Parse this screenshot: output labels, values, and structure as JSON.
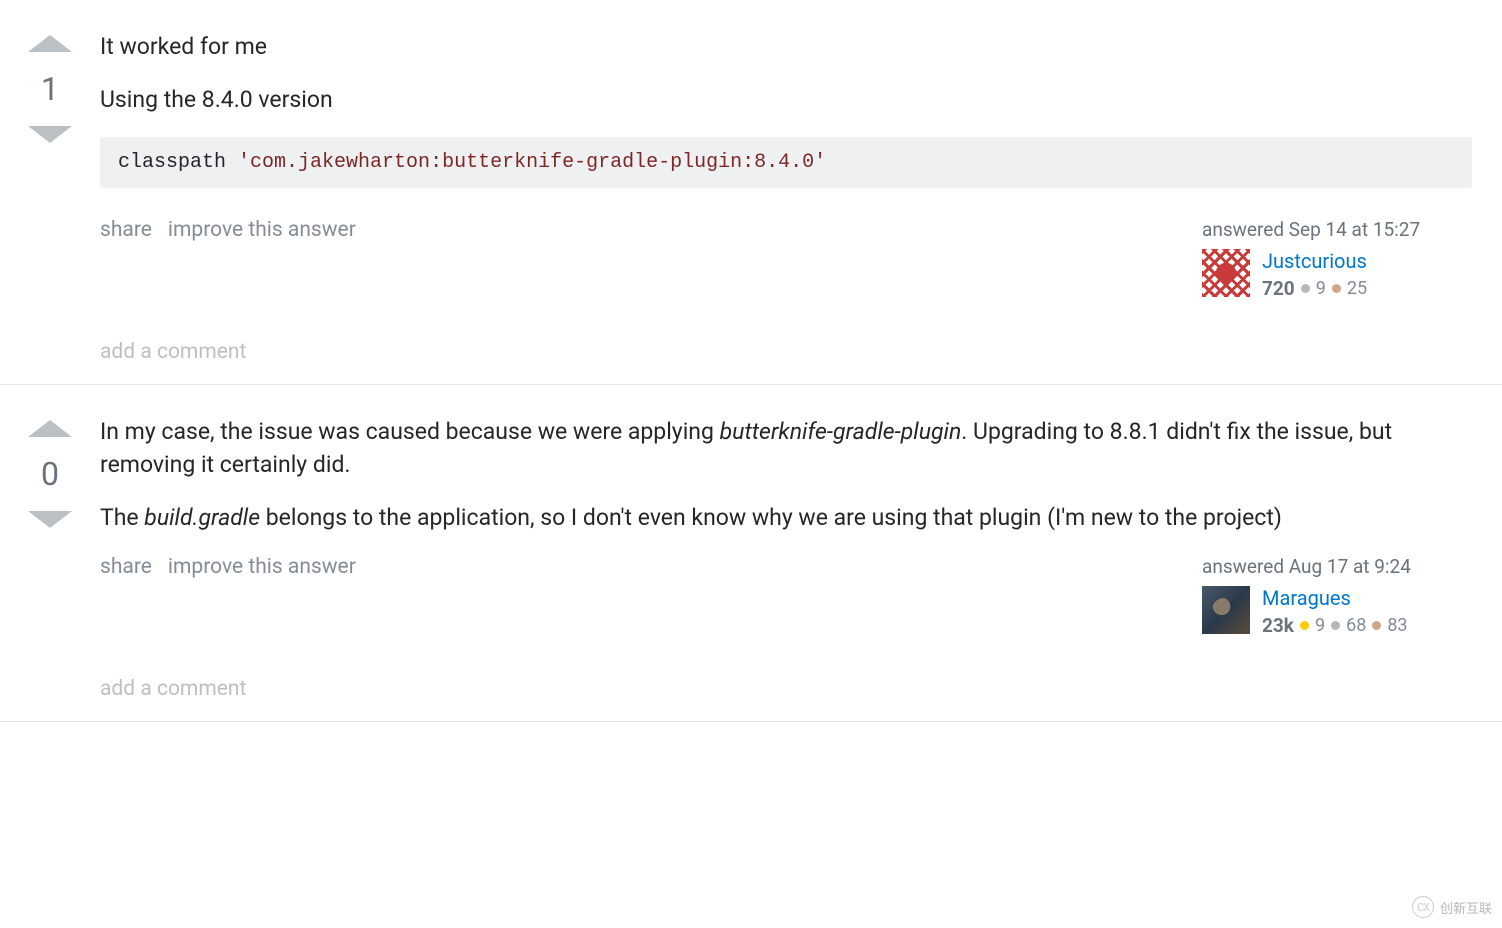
{
  "answers": [
    {
      "votes": "1",
      "body": {
        "p1": "It worked for me",
        "p2": "Using the 8.4.0 version",
        "code_keyword": "classpath ",
        "code_string": "'com.jakewharton:butterknife-gradle-plugin:8.4.0'"
      },
      "actions": {
        "share": "share",
        "improve": "improve this answer"
      },
      "answered_label": "answered Sep 14 at 15:27",
      "user": {
        "name": "Justcurious",
        "rep": "720",
        "silver": "9",
        "bronze": "25"
      },
      "add_comment": "add a comment"
    },
    {
      "votes": "0",
      "body": {
        "p1_a": "In my case, the issue was caused because we were applying ",
        "p1_em": "butterknife-gradle-plugin",
        "p1_b": ". Upgrading to 8.8.1 didn't fix the issue, but removing it certainly did.",
        "p2_a": "The ",
        "p2_em": "build.gradle",
        "p2_b": " belongs to the application, so I don't even know why we are using that plugin (I'm new to the project)"
      },
      "actions": {
        "share": "share",
        "improve": "improve this answer"
      },
      "answered_label": "answered Aug 17 at 9:24",
      "user": {
        "name": "Maragues",
        "rep": "23k",
        "gold": "9",
        "silver": "68",
        "bronze": "83"
      },
      "add_comment": "add a comment"
    }
  ],
  "watermark": "创新互联"
}
